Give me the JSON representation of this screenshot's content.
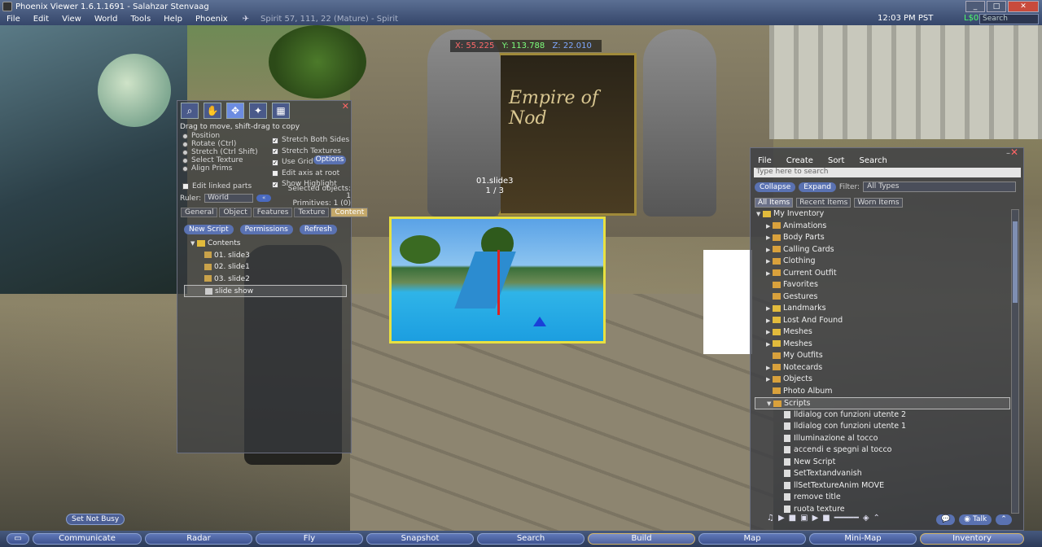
{
  "window": {
    "title": "Phoenix Viewer 1.6.1.1691 - Salahzar Stenvaag",
    "buttons": [
      "_",
      "□",
      "✕"
    ]
  },
  "menu": [
    "File",
    "Edit",
    "View",
    "World",
    "Tools",
    "Help",
    "Phoenix"
  ],
  "location": "Spirit 57, 111, 22 (Mature) - Spirit",
  "clock": "12:03 PM PST",
  "money": "L$0",
  "search_placeholder": "Search",
  "hud": {
    "x": "X: 55.225",
    "y": "Y: 113.788",
    "z": "Z: 22.010",
    "slide_name": "01.slide3",
    "slide_count": "1 / 3",
    "banner": "Empire of Nod"
  },
  "build": {
    "hint": "Drag to move, shift-drag to copy",
    "modes": [
      "Position",
      "Rotate (Ctrl)",
      "Stretch (Ctrl Shift)",
      "Select Texture",
      "Align Prims"
    ],
    "checks": [
      "Stretch Both Sides",
      "Stretch Textures",
      "Use Grid",
      "Edit axis at root",
      "Show Highlight"
    ],
    "options_label": "Options",
    "edit_linked": "Edit linked parts",
    "ruler_label": "Ruler:",
    "ruler_value": "World",
    "selected_objects": "Selected objects: 1",
    "primitives": "Primitives: 1 (0)",
    "tabs": [
      "General",
      "Object",
      "Features",
      "Texture",
      "Content"
    ],
    "content_buttons": [
      "New Script",
      "Permissions",
      "Refresh"
    ],
    "contents_folder": "Contents",
    "items": [
      "01. slide3",
      "02. slide1",
      "03. slide2",
      "slide show"
    ]
  },
  "inventory": {
    "menu": [
      "File",
      "Create",
      "Sort",
      "Search"
    ],
    "search_placeholder": "Type here to search",
    "collapse": "Collapse",
    "expand": "Expand",
    "filter_label": "Filter:",
    "filter_value": "All Types",
    "tabs": [
      "All Items",
      "Recent Items",
      "Worn Items"
    ],
    "root": "My Inventory",
    "folders": [
      "Animations",
      "Body Parts",
      "Calling Cards",
      "Clothing",
      "Current Outfit",
      "Favorites",
      "Gestures",
      "Landmarks",
      "Lost And Found",
      "Meshes",
      "Meshes",
      "My Outfits",
      "Notecards",
      "Objects",
      "Photo Album",
      "Scripts"
    ],
    "scripts": [
      "lldialog con funzioni utente 2",
      "lldialog con funzioni utente 1",
      "Illuminazione al tocco",
      "accendi e spegni al tocco",
      "New Script",
      "SetTextandvanish",
      "llSetTextureAnim MOVE",
      "remove title",
      "ruota texture"
    ]
  },
  "set_not_busy": "Set Not Busy",
  "talk": "Talk",
  "bottom": [
    "Communicate",
    "Radar",
    "Fly",
    "Snapshot",
    "Search",
    "Build",
    "Map",
    "Mini-Map",
    "Inventory"
  ]
}
